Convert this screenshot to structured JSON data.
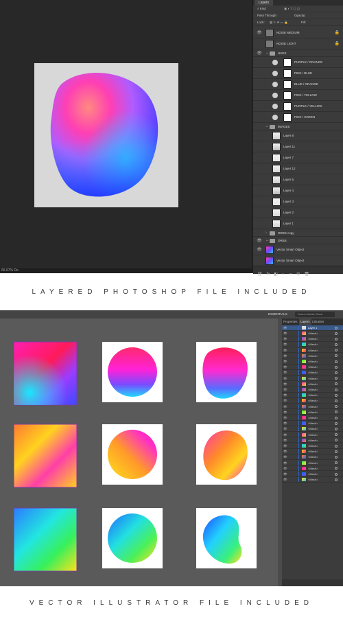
{
  "photoshop": {
    "panel_tab": "Layers",
    "filter_label": "Kind",
    "blend_mode": "Pass Through",
    "opacity_label": "Opacity:",
    "lock_label": "Lock:",
    "fill_label": "Fill:",
    "status_text": "66.67% Do",
    "layers": [
      {
        "name": "NOISE MEDIUM",
        "kind": "layer",
        "visible": true,
        "locked": true
      },
      {
        "name": "NOISE LIGHT",
        "kind": "layer",
        "visible": false,
        "locked": true
      },
      {
        "name": "HUES",
        "kind": "group",
        "visible": true,
        "locked": false
      },
      {
        "name": "PURPLE / ORANGE",
        "kind": "adjustment",
        "visible": false,
        "locked": false
      },
      {
        "name": "PINK / BLUE",
        "kind": "adjustment",
        "visible": false,
        "locked": false
      },
      {
        "name": "BLUE / ORANGE",
        "kind": "adjustment",
        "visible": false,
        "locked": false
      },
      {
        "name": "PINK / YELLOW",
        "kind": "adjustment",
        "visible": false,
        "locked": false
      },
      {
        "name": "PURPLE / YELLOW",
        "kind": "adjustment",
        "visible": false,
        "locked": false
      },
      {
        "name": "PINK / GREEN",
        "kind": "adjustment",
        "visible": false,
        "locked": false
      },
      {
        "name": "IMAGES",
        "kind": "group",
        "visible": false,
        "locked": false
      },
      {
        "name": "Layer 8",
        "kind": "image",
        "visible": false,
        "locked": false
      },
      {
        "name": "Layer 11",
        "kind": "image",
        "visible": false,
        "locked": false
      },
      {
        "name": "Layer 7",
        "kind": "image",
        "visible": false,
        "locked": false
      },
      {
        "name": "Layer 12",
        "kind": "image",
        "visible": false,
        "locked": false
      },
      {
        "name": "Layer 5",
        "kind": "image",
        "visible": false,
        "locked": false
      },
      {
        "name": "Layer 4",
        "kind": "image",
        "visible": false,
        "locked": false
      },
      {
        "name": "Layer 3",
        "kind": "image",
        "visible": false,
        "locked": false
      },
      {
        "name": "Layer 2",
        "kind": "image",
        "visible": false,
        "locked": false
      },
      {
        "name": "Layer 1",
        "kind": "image",
        "visible": false,
        "locked": false
      },
      {
        "name": "ORBS copy",
        "kind": "group",
        "visible": false,
        "locked": false
      },
      {
        "name": "ORBS",
        "kind": "group",
        "visible": true,
        "locked": false
      },
      {
        "name": "Vector Smart Object",
        "kind": "smart",
        "visible": true,
        "locked": false
      },
      {
        "name": "Vector Smart Object",
        "kind": "smart",
        "visible": false,
        "locked": false
      }
    ]
  },
  "captions": {
    "ps": "LAYERED PHOTOSHOP FILE INCLUDED",
    "ai": "VECTOR ILLUSTRATOR FILE INCLUDED"
  },
  "illustrator": {
    "workspace": "ESSENTIALS",
    "search_placeholder": "Search Adobe Stock",
    "tabs": [
      "Properties",
      "Layers",
      "Libraries"
    ],
    "top_layer": "Layer 1",
    "mesh_label": "<Mesh>",
    "mesh_count": 27
  },
  "colors": {
    "ps_bg": "#282828",
    "ai_bg": "#5a5a5a",
    "accent_blue": "#2f67c8"
  }
}
